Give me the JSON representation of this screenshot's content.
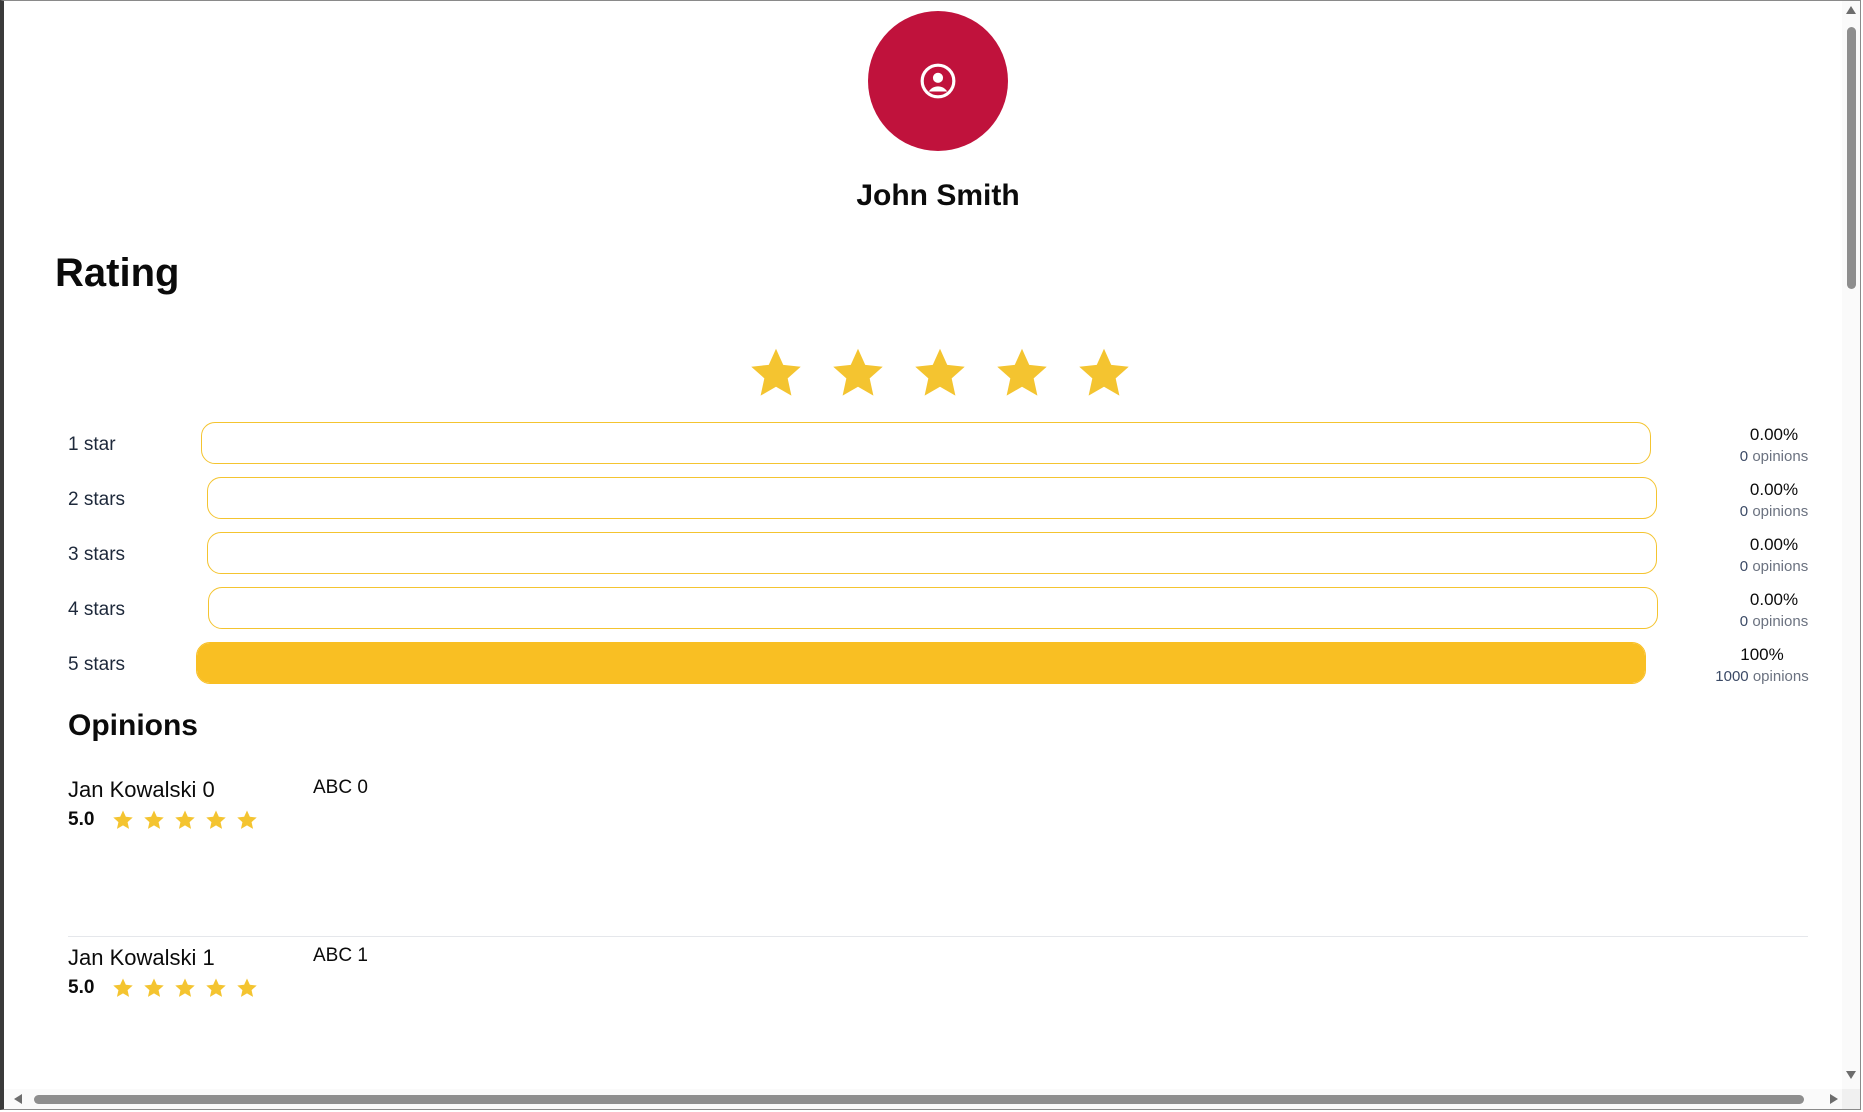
{
  "profile": {
    "name": "John Smith",
    "avatar_icon": "user-circle-icon",
    "avatar_color": "#c0123c"
  },
  "rating": {
    "title": "Rating",
    "average_stars": 5,
    "star_color": "#f4c430",
    "distribution": [
      {
        "label": "1 star",
        "percent": "0.00%",
        "fill_fraction": 0,
        "count": "0",
        "count_suffix": "opinions"
      },
      {
        "label": "2 stars",
        "percent": "0.00%",
        "fill_fraction": 0,
        "count": "0",
        "count_suffix": "opinions"
      },
      {
        "label": "3 stars",
        "percent": "0.00%",
        "fill_fraction": 0,
        "count": "0",
        "count_suffix": "opinions"
      },
      {
        "label": "4 stars",
        "percent": "0.00%",
        "fill_fraction": 0,
        "count": "0",
        "count_suffix": "opinions"
      },
      {
        "label": "5 stars",
        "percent": "100%",
        "fill_fraction": 1,
        "count": "1000",
        "count_suffix": "opinions"
      }
    ]
  },
  "opinions": {
    "title": "Opinions",
    "items": [
      {
        "author": "Jan Kowalski 0",
        "score": "5.0",
        "stars": 5,
        "text": "ABC 0"
      },
      {
        "author": "Jan Kowalski 1",
        "score": "5.0",
        "stars": 5,
        "text": "ABC 1"
      }
    ]
  }
}
